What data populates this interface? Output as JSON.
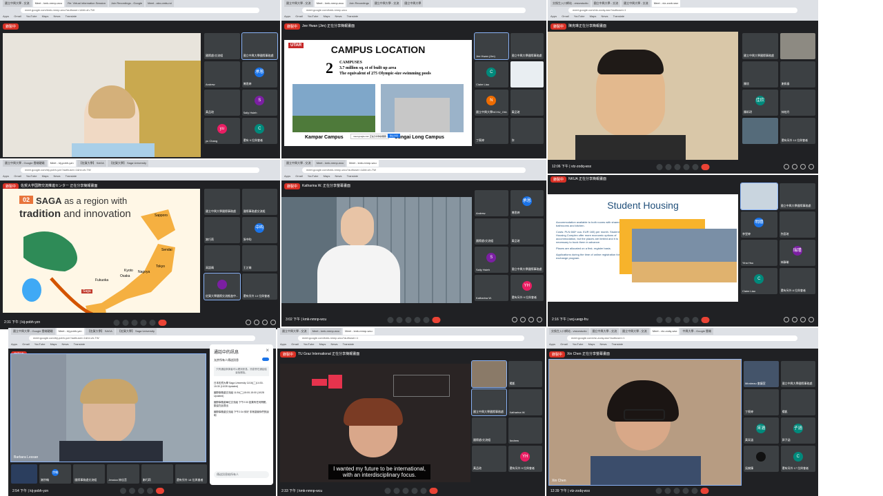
{
  "panels": [
    {
      "tabs": [
        "國立中興大學 - 交流",
        "Meet - kmk-nmnp-wcu",
        "Re: Virtual information Session",
        "Join Recordings - Google",
        "Meet - akn-omts-roi"
      ],
      "url": "meet.google.com/kmk-nmnp-wcu?authuser=1&hl=zh-TW",
      "bookmarks": [
        "Apps",
        "Gmail",
        "YouTube",
        "Maps",
        "News",
        "Translate"
      ],
      "rec": "錄製中",
      "presenter": "",
      "tiles": [
        {
          "name": "國際處/交流組",
          "initial": "",
          "color": "#3c4043"
        },
        {
          "name": "國立中興大學國際事務處",
          "initial": "",
          "color": "#3c4043"
        },
        {
          "name": "Andrew",
          "initial": "",
          "color": "#3c4043"
        },
        {
          "name": "傅思婷",
          "initial": "承恩",
          "color": "#1a73e8"
        },
        {
          "name": "黃品瑄",
          "initial": "",
          "color": "#3c4043"
        },
        {
          "name": "Sally Hsieh",
          "initial": "S",
          "color": "#7b1fa2"
        },
        {
          "name": "yu Chang",
          "initial": "yu",
          "color": "#e91e63"
        },
        {
          "name": "還有 9 位與會者",
          "initial": "C",
          "color": "#00897b"
        }
      ],
      "time": "",
      "more": ""
    },
    {
      "tabs": [
        "國立中興大學 - 交流",
        "Meet - kmk-nmnp-wcu",
        "Join Recordings",
        "國立中興大學 - 交流",
        "國立中興大學"
      ],
      "url": "meet.google.com/kmk-nmnp-wcu",
      "bookmarks": [
        "Apps",
        "Gmail",
        "YouTube",
        "Maps",
        "News",
        "Translate"
      ],
      "rec": "錄製中",
      "presenter": "Jee Hwan (Jim) 正在分享簡報畫面",
      "slide_title": "CAMPUS LOCATION",
      "slide_logo": "UTAR",
      "slide_number": "2",
      "slide_head": "CAMPUSES",
      "slide_line1": "3.7 million sq. st of built up area",
      "slide_line2": "The equivalent of 275 Olympic-size swimming pools",
      "caption_left": "Kampar Campus",
      "caption_right": "Sungai Long Campus",
      "share_note": "meet.google.com 正在分享你的螢幕",
      "share_button": "停止分享",
      "tiles": [
        {
          "name": "Jee Hwan (Jim)",
          "initial": "",
          "color": "#3c4043"
        },
        {
          "name": "國立中興大學國際事務處",
          "initial": "",
          "color": "#3c4043"
        },
        {
          "name": "Claire Liao",
          "initial": "C",
          "color": "#00897b"
        },
        {
          "name": "",
          "initial": "",
          "color": "#3c4043"
        },
        {
          "name": "國立中興大學NCHU_OIA",
          "initial": "N",
          "color": "#ef6c00"
        },
        {
          "name": "黃品瑄",
          "initial": "",
          "color": "#3c4043"
        },
        {
          "name": "丁筱婷",
          "initial": "",
          "color": "#3c4043"
        },
        {
          "name": "你",
          "initial": "",
          "color": "#3c4043"
        }
      ]
    },
    {
      "tabs": [
        "交換生入口網站 - visiorstudio",
        "國立中興大學 - 交流",
        "國立中興大學 - 交流",
        "Meet - vtz-zoxb-wsx"
      ],
      "url": "meet.google.com/vtz-zodq-wsx?authuser=1",
      "bookmarks": [
        "Apps",
        "Gmail",
        "YouTube",
        "Maps",
        "News",
        "Translate"
      ],
      "rec": "錄製中",
      "presenter": "陳克琳正在分享簡報畫面",
      "tiles": [
        {
          "name": "國立中興大學國際事務處",
          "initial": "",
          "color": "#3c4043"
        },
        {
          "name": "",
          "initial": "",
          "color": "#3c4043"
        },
        {
          "name": "陳欣",
          "initial": "",
          "color": "#3c4043"
        },
        {
          "name": "謝佩秦",
          "initial": "",
          "color": "#3c4043"
        },
        {
          "name": "陳昕玥",
          "initial": "佳欣",
          "color": "#00897b"
        },
        {
          "name": "林柏丹",
          "initial": "",
          "color": "#3c4043"
        },
        {
          "name": "",
          "initial": "",
          "color": "#3c4043"
        },
        {
          "name": "還有另外 10 位與會者",
          "initial": "",
          "color": "#3c4043"
        }
      ],
      "time": "12:06 下午",
      "meeting": "vtz-zodq-wsx",
      "you": "你"
    },
    {
      "tabs": [
        "國立中興大學 - Google 雲端硬碟",
        "Meet - kij-pobh-yzn",
        "【佐賀大學】 SAGA",
        "【佐賀大學】 Saga University"
      ],
      "url": "meet.google.com/kij-pobh-yzn?authuser=1&hl=zh-TW",
      "bookmarks": [
        "Apps",
        "Gmail",
        "YouTube",
        "Maps",
        "News",
        "Translate"
      ],
      "rec": "錄製中",
      "presenter": "佐賀大学国際交流推進センター 正在分享簡報畫面",
      "slide_num": "02",
      "slide_title_a": "SAGA",
      "slide_title_b": " as a region with",
      "slide_title_c": "tradition",
      "slide_title_d": " and innovation",
      "cities": [
        "Sapporo",
        "Sendai",
        "Tokyo",
        "Nagoya",
        "Kyoto",
        "Osaka",
        "Fukuoka",
        "Saga"
      ],
      "tiles": [
        {
          "name": "國立中興大學國際事務處",
          "initial": "",
          "color": "#3c4043"
        },
        {
          "name": "國際事務處交流組",
          "initial": "",
          "color": "#3c4043"
        },
        {
          "name": "謝巧莉",
          "initial": "",
          "color": "#3c4043"
        },
        {
          "name": "張中昀",
          "initial": "中昀",
          "color": "#1a73e8"
        },
        {
          "name": "高語晴",
          "initial": "",
          "color": "#3c4043"
        },
        {
          "name": "王芷瑜",
          "initial": "",
          "color": "#3c4043"
        },
        {
          "name": "佐賀大學國際交流推進中...",
          "initial": "",
          "color": "#7b1fa2"
        },
        {
          "name": "還有另外 10 位與會者",
          "initial": "",
          "color": "#3c4043"
        }
      ],
      "time": "2:31 下午",
      "meeting": "kij-pobh-yzn",
      "you": "你"
    },
    {
      "tabs": [
        "國立中興大學 - 交流",
        "Meet - kmk-nmnp-wcu",
        "Meet - kmk-nmnp-wcu"
      ],
      "url": "meet.google.com/kmk-nmnp-wcu?authuser=1&hl=zh-TW",
      "bookmarks": [
        "Apps",
        "Gmail",
        "YouTube",
        "Maps",
        "News",
        "Translate"
      ],
      "rec": "錄製中",
      "presenter": "Katharina W. 正在分享螢幕畫面",
      "tiles": [
        {
          "name": "Andrew",
          "initial": "",
          "color": "#3c4043"
        },
        {
          "name": "傅思婷",
          "initial": "承恩",
          "color": "#1a73e8"
        },
        {
          "name": "國際處/交流組",
          "initial": "",
          "color": "#3c4043"
        },
        {
          "name": "黃品瑄",
          "initial": "",
          "color": "#3c4043"
        },
        {
          "name": "Sally Hsieh",
          "initial": "S",
          "color": "#7b1fa2"
        },
        {
          "name": "國立中興大學國際事務處",
          "initial": "",
          "color": "#3c4043"
        },
        {
          "name": "Katharina W.",
          "initial": "",
          "color": "#3c4043"
        },
        {
          "name": "還有另外 9 位與會者",
          "initial": "YH",
          "color": "#e91e63"
        }
      ],
      "time": "3:02 下午",
      "meeting": "kmk-nmnp-wcu",
      "you": "你"
    },
    {
      "tabs": [
        "國立中興大學 - 交流",
        "國立中興大學 - 交流",
        "Meet - wcj-ueqp-fru"
      ],
      "url": "meet.google.com/wcj-ueqp-fru",
      "bookmarks": [
        "Apps",
        "Gmail",
        "YouTube",
        "Maps",
        "News",
        "Translate"
      ],
      "rec": "錄製中",
      "presenter": "NKUA 正在分享簡報畫面",
      "slide_title": "Student Housing",
      "p1": "Accommodation available to both rooms with shared bathrooms and kitchen.",
      "p2": "Costs: PLN 660* cca. EUR 165) per month. Student Housing Complex offer more economic options of accommodation, but the places are limited and it is necessary to book them in advance.",
      "p3": "Places are allocated on a first- register basis.",
      "p4": "Applications during the time of online registration for the exchange program.",
      "tiles": [
        {
          "name": "",
          "initial": "",
          "color": "#3c4043"
        },
        {
          "name": "國立中興大學國際事務處",
          "initial": "",
          "color": "#3c4043"
        },
        {
          "name": "李昱婷",
          "initial": "明穗",
          "color": "#1a73e8"
        },
        {
          "name": "許庭瑄",
          "initial": "",
          "color": "#3c4043"
        },
        {
          "name": "Yina Hsu",
          "initial": "",
          "color": "#3c4043"
        },
        {
          "name": "林靜瑜",
          "initial": "瑞瑾",
          "color": "#7b1fa2"
        },
        {
          "name": "Claire Liao",
          "initial": "C",
          "color": "#00897b"
        },
        {
          "name": "還有另外 8 位與會者",
          "initial": "",
          "color": "#3c4043"
        }
      ],
      "time": "2:16 下午",
      "meeting": "wcj-ueqp-fru",
      "you": "你"
    },
    {
      "tabs": [
        "國立中興大學 - Google 雲端硬碟",
        "Meet - kij-pobh-yzn",
        "【佐賀大學】 SAGA",
        "【佐賀大學】 Saga University"
      ],
      "url": "meet.google.com/kij-pobh-yzn?authuser=1&hl=zh-TW",
      "bookmarks": [
        "Apps",
        "Gmail",
        "YouTube",
        "Maps",
        "News",
        "Translate"
      ],
      "rec": "錄製中",
      "speaker_name": "Barbara Lessan",
      "chat_title": "通話中的訊息",
      "chat_toggle": "允許所有人傳送訊息",
      "chat_note": "只有通話參與者可以看到訊息。訊息會在通話結束後刪除。",
      "chat_msgs": [
        "日本佐賀大學 Saga University 11/16(二)14:30-15:30 (10/28 Updated)",
        "國際事務處交流組 11/16(二)15:00-15:00 (10/28 Updated)",
        "國際事務處單位交流組 下午2:33 如果有任何問題，歡迎在此提出",
        "國際事務處交流組 下午2:34 你好 非常感謝你們的說明"
      ],
      "chat_input": "傳送訊息給所有人",
      "tiles": [
        {
          "name": "謝宗翰",
          "initial": "宗翰",
          "color": "#1a73e8"
        },
        {
          "name": "國際事務處交流組",
          "initial": "",
          "color": "#3c4043"
        },
        {
          "name": "Jessica 林佳音",
          "initial": "",
          "color": "#3c4043"
        },
        {
          "name": "謝巧莉",
          "initial": "",
          "color": "#3c4043"
        },
        {
          "name": "還有另外 18 位與會者",
          "initial": "",
          "color": "#3c4043"
        }
      ],
      "time": "2:54 下午",
      "meeting": "kij-pobh-yzn"
    },
    {
      "tabs": [
        "國立中興大學 - 交流",
        "Meet - kmk-nmnp-wcu",
        "Meet - kmk-nmnp-wcu"
      ],
      "url": "meet.google.com/kmk-nmnp-wcu?authuser=1",
      "bookmarks": [
        "Apps",
        "Gmail",
        "YouTube",
        "Maps",
        "News",
        "Translate"
      ],
      "rec": "錄製中",
      "presenter": "TU Graz International 正在分享簡報畫面",
      "caption1": "I wanted my future to be international,",
      "caption2": "with an interdisciplinary focus.",
      "tiles": [
        {
          "name": "",
          "initial": "",
          "color": "#3c4043"
        },
        {
          "name": "楊凱",
          "initial": "",
          "color": "#3c4043"
        },
        {
          "name": "國立中興大學國際事務處",
          "initial": "",
          "color": "#3c4043"
        },
        {
          "name": "Katharina W.",
          "initial": "",
          "color": "#3c4043"
        },
        {
          "name": "國際處/交流組",
          "initial": "",
          "color": "#3c4043"
        },
        {
          "name": "Andrew",
          "initial": "",
          "color": "#3c4043"
        },
        {
          "name": "黃品瑄",
          "initial": "",
          "color": "#3c4043"
        },
        {
          "name": "還有另外 9 位與會者",
          "initial": "YH",
          "color": "#e91e63"
        }
      ],
      "time": "2:33 下午",
      "meeting": "kmk-nmnp-wcu",
      "you": "你"
    },
    {
      "tabs": [
        "交換生入口網站 - visiorstudio",
        "國立中興大學 - 交流",
        "國立中興大學 - 交流",
        "Meet - vtz-zodq-wsx",
        "中興大學 - Google 雲端"
      ],
      "url": "meet.google.com/vtz-zodq-wsx?authuser=1",
      "bookmarks": [
        "Apps",
        "Gmail",
        "YouTube",
        "Maps",
        "News",
        "Translate"
      ],
      "rec": "錄製中",
      "presenter": "Xin Chen 正在分享螢幕畫面",
      "speaker_name": "Xin Chen",
      "tiles": [
        {
          "name": "Mirabeau 會議室",
          "initial": "",
          "color": "#3c4043"
        },
        {
          "name": "國立中興大學國際事務處",
          "initial": "",
          "color": "#3c4043"
        },
        {
          "name": "丁筱婷",
          "initial": "",
          "color": "#3c4043"
        },
        {
          "name": "楊凱",
          "initial": "",
          "color": "#3c4043"
        },
        {
          "name": "黃采涵",
          "initial": "采涵",
          "color": "#00897b"
        },
        {
          "name": "郭子涵",
          "initial": "子涵",
          "color": "#00897b"
        },
        {
          "name": "吳婉臻",
          "initial": "",
          "color": "#3c4043"
        },
        {
          "name": "還有另外 17 位與會者",
          "initial": "C",
          "color": "#00897b"
        }
      ],
      "time": "12:39 下午",
      "meeting": "vtz-zodq-wsx",
      "you": "你"
    }
  ]
}
